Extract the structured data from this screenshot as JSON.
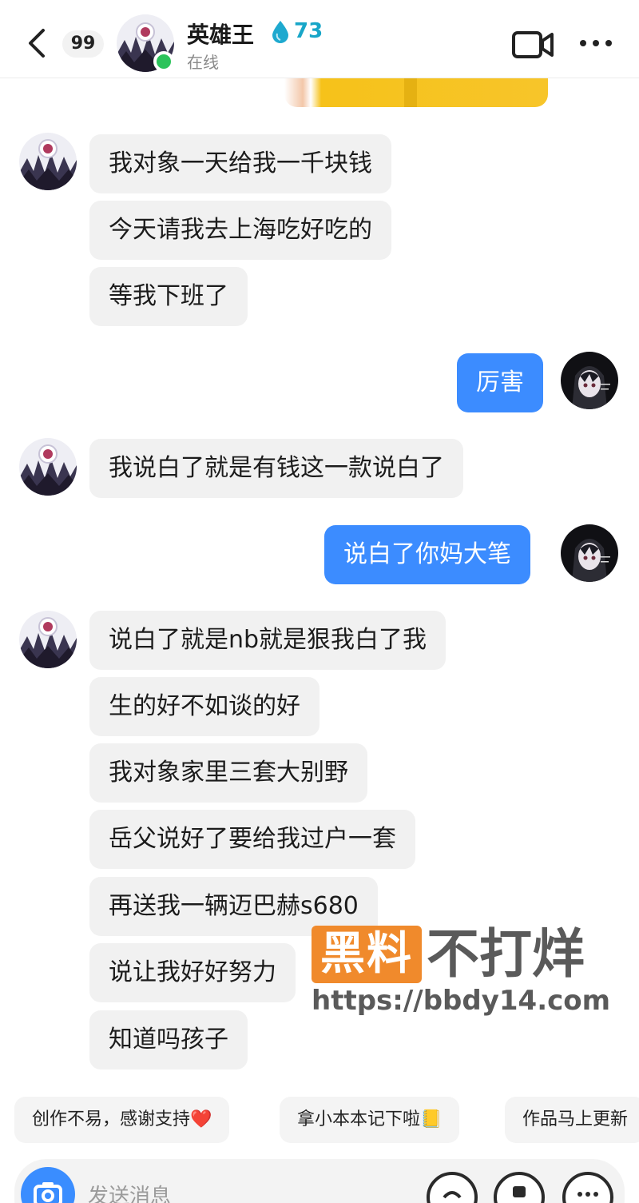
{
  "header": {
    "back_label": "",
    "unread_count": "99",
    "contact_name": "英雄王",
    "flame_count": "73",
    "contact_status": "在线"
  },
  "messages": [
    {
      "side": "in",
      "text": "我对象一天给我一千块钱"
    },
    {
      "side": "in",
      "text": "今天请我去上海吃好吃的"
    },
    {
      "side": "in",
      "text": "等我下班了"
    },
    {
      "side": "out",
      "text": "厉害"
    },
    {
      "side": "in",
      "text": "我说白了就是有钱这一款说白了"
    },
    {
      "side": "out",
      "text": "说白了你妈大笔"
    },
    {
      "side": "in",
      "text": "说白了就是nb就是狠我白了我"
    },
    {
      "side": "in",
      "text": "生的好不如谈的好"
    },
    {
      "side": "in",
      "text": "我对象家里三套大别野"
    },
    {
      "side": "in",
      "text": "岳父说好了要给我过户一套"
    },
    {
      "side": "in",
      "text": "再送我一辆迈巴赫s680"
    },
    {
      "side": "in",
      "text": "说让我好好努力"
    },
    {
      "side": "in",
      "text": "知道吗孩子"
    }
  ],
  "watermark": {
    "box_text": "黑料",
    "text": "不打烊",
    "url": "https://bbdy14.com"
  },
  "quick_replies": [
    "创作不易，感谢支持❤️",
    "拿小本本记下啦📒",
    "作品马上更新"
  ],
  "composer": {
    "placeholder": "发送消息"
  },
  "colors": {
    "outgoing_bubble": "#3c8cff",
    "incoming_bubble": "#f1f1f1",
    "online": "#2bc35a",
    "watermark_orange": "#f08a2c"
  }
}
